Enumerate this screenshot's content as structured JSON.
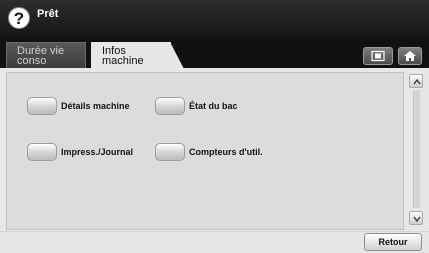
{
  "status": {
    "help_icon": "?",
    "text": "Prêt"
  },
  "tabs": [
    {
      "line1": "Durée vie",
      "line2": "conso",
      "active": false
    },
    {
      "line1": "Infos",
      "line2": "machine",
      "active": true
    }
  ],
  "top_buttons": {
    "copy_icon": "copy-screen-icon",
    "home_icon": "home-icon"
  },
  "menu": {
    "details": "Détails machine",
    "etat_bac": "État du bac",
    "impress_journal": "Impress./Journal",
    "compteurs": "Compteurs d'util."
  },
  "footer": {
    "retour": "Retour"
  },
  "colors": {
    "topbar": "#151515",
    "background": "#e7e7e7",
    "panel": "#dcdcdc"
  }
}
